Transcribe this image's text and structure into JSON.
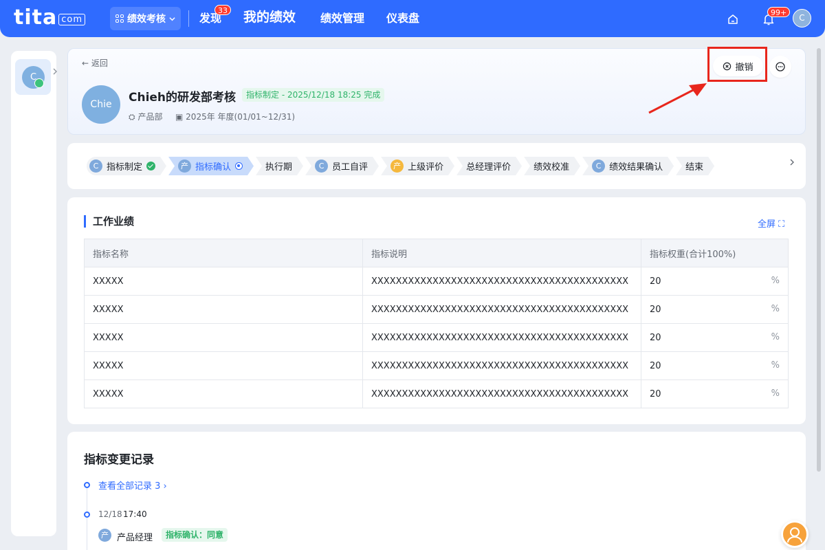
{
  "app": {
    "logo_main": "tita",
    "logo_suffix": "com"
  },
  "nav": {
    "module_switch": "绩效考核",
    "items": [
      {
        "label": "发现",
        "badge": "33"
      },
      {
        "label": "我的绩效"
      },
      {
        "label": "绩效管理"
      },
      {
        "label": "仪表盘"
      }
    ],
    "notification_badge": "99+",
    "user_initial": "C"
  },
  "rail": {
    "avatar_initial": "C"
  },
  "header": {
    "back_label": "← 返回",
    "avatar_text": "Chie",
    "title": "Chieh的研发部考核",
    "status_tag": "指标制定 - 2025/12/18 18:25 完成",
    "department": "产品部",
    "period": "2025年 年度(01/01~12/31)",
    "revoke_label": "撤销"
  },
  "stepper": {
    "steps": [
      {
        "label": "指标制定",
        "avatar": "C",
        "avatar_color": "blue",
        "state": "done"
      },
      {
        "label": "指标确认",
        "avatar": "产",
        "avatar_color": "blue",
        "state": "current"
      },
      {
        "label": "执行期",
        "avatar": "",
        "state": "todo"
      },
      {
        "label": "员工自评",
        "avatar": "C",
        "avatar_color": "blue",
        "state": "todo"
      },
      {
        "label": "上级评价",
        "avatar": "产",
        "avatar_color": "yellow",
        "state": "todo"
      },
      {
        "label": "总经理评价",
        "avatar": "",
        "state": "todo"
      },
      {
        "label": "绩效校准",
        "avatar": "",
        "state": "todo"
      },
      {
        "label": "绩效结果确认",
        "avatar": "C",
        "avatar_color": "blue",
        "state": "todo"
      },
      {
        "label": "结束",
        "avatar": "",
        "state": "todo"
      }
    ],
    "next_icon": "chevron-right-icon"
  },
  "work": {
    "title": "工作业绩",
    "fullscreen_label": "全屏 ⛶",
    "columns": [
      "指标名称",
      "指标说明",
      "指标权重(合计100%)"
    ],
    "rows": [
      {
        "name": "XXXXX",
        "desc": "XXXXXXXXXXXXXXXXXXXXXXXXXXXXXXXXXXXXXXXXXX",
        "weight": "20",
        "unit": "%"
      },
      {
        "name": "XXXXX",
        "desc": "XXXXXXXXXXXXXXXXXXXXXXXXXXXXXXXXXXXXXXXXXX",
        "weight": "20",
        "unit": "%"
      },
      {
        "name": "XXXXX",
        "desc": "XXXXXXXXXXXXXXXXXXXXXXXXXXXXXXXXXXXXXXXXXX",
        "weight": "20",
        "unit": "%"
      },
      {
        "name": "XXXXX",
        "desc": "XXXXXXXXXXXXXXXXXXXXXXXXXXXXXXXXXXXXXXXXXX",
        "weight": "20",
        "unit": "%"
      },
      {
        "name": "XXXXX",
        "desc": "XXXXXXXXXXXXXXXXXXXXXXXXXXXXXXXXXXXXXXXXXX",
        "weight": "20",
        "unit": "%"
      }
    ]
  },
  "log": {
    "title": "指标变更记录",
    "view_all": "查看全部记录 3 ›",
    "entries": [
      {
        "date": "12/18",
        "time": "17:40",
        "actor_avatar": "产",
        "actor": "产品经理",
        "tag": "指标确认：同意"
      }
    ]
  },
  "colors": {
    "brand": "#2f6bff",
    "success": "#2fb36a",
    "highlight": "#e8261c"
  }
}
